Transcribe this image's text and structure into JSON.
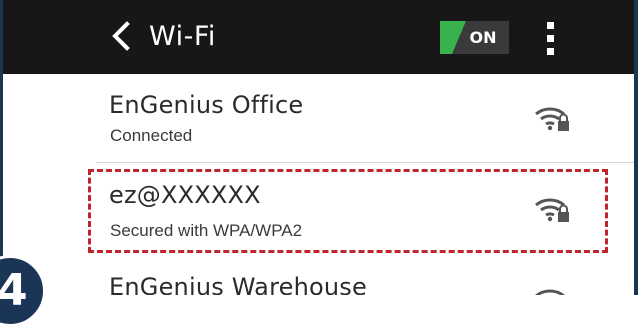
{
  "header": {
    "title": "Wi-Fi",
    "toggle_label": "ON",
    "toggle_color": "#37b24d"
  },
  "networks": [
    {
      "name": "EnGenius Office",
      "status": "Connected",
      "icon": "wifi-locked-icon"
    },
    {
      "name": "ez@XXXXXX",
      "status": "Secured with WPA/WPA2",
      "icon": "wifi-locked-icon",
      "highlighted": true
    },
    {
      "name": "EnGenius Warehouse",
      "status": "",
      "icon": "wifi-locked-icon"
    }
  ],
  "step_badge": "4",
  "colors": {
    "action_bar": "#171717",
    "highlight_border": "#c0252d",
    "frame": "#1b3556"
  }
}
